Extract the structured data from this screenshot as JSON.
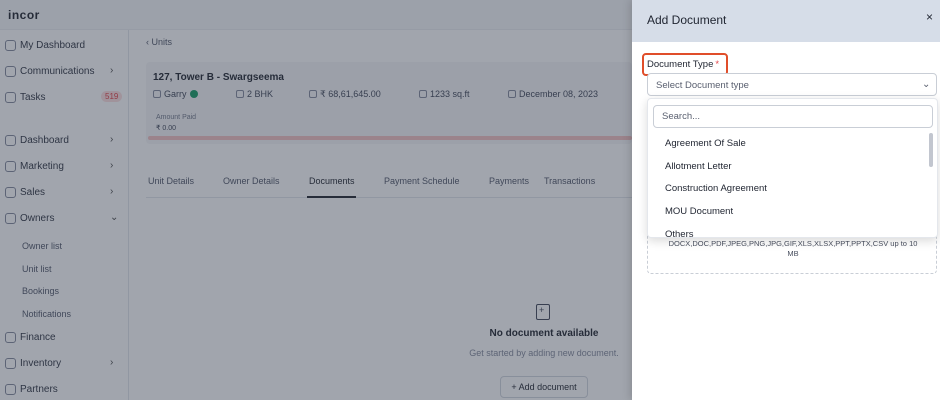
{
  "app": {
    "logo": "incor",
    "sidebar": {
      "items": [
        {
          "label": "My Dashboard"
        },
        {
          "label": "Communications"
        },
        {
          "label": "Tasks",
          "badge": "519"
        },
        {
          "label": "Dashboard"
        },
        {
          "label": "Marketing"
        },
        {
          "label": "Sales"
        },
        {
          "label": "Owners"
        },
        {
          "label": "Finance"
        },
        {
          "label": "Inventory"
        },
        {
          "label": "Partners"
        }
      ],
      "owners_sub": [
        "Owner list",
        "Unit list",
        "Bookings",
        "Notifications"
      ]
    },
    "breadcrumb": "Units",
    "unit": {
      "title": "127, Tower B - Swargseema",
      "owner": "Garry",
      "config": "2 BHK",
      "price": "₹ 68,61,645.00",
      "area": "1233 sq.ft",
      "date": "December 08, 2023",
      "amount_paid_label": "Amount Paid",
      "amount_paid": "₹ 0.00"
    },
    "tabs": [
      "Unit Details",
      "Owner Details",
      "Documents",
      "Payment Schedule",
      "Payments",
      "Transactions"
    ],
    "active_tab": "Documents",
    "empty_state": {
      "title": "No document available",
      "subtitle": "Get started by adding new document.",
      "button": "+ Add document"
    }
  },
  "drawer": {
    "title": "Add Document",
    "close": "×",
    "field_label": "Document Type",
    "required_mark": "*",
    "select_placeholder": "Select Document type",
    "search_placeholder": "Search...",
    "options": [
      "Agreement Of Sale",
      "Allotment Letter",
      "Construction Agreement",
      "MOU Document",
      "Others"
    ],
    "upload_hint": "DOCX,DOC,PDF,JPEG,PNG,JPG,GIF,XLS,XLSX,PPT,PPTX,CSV up to 10 MB"
  },
  "colors": {
    "highlight": "#e04e2a",
    "required": "#e5484d",
    "drawer_header": "#d6dde8"
  }
}
